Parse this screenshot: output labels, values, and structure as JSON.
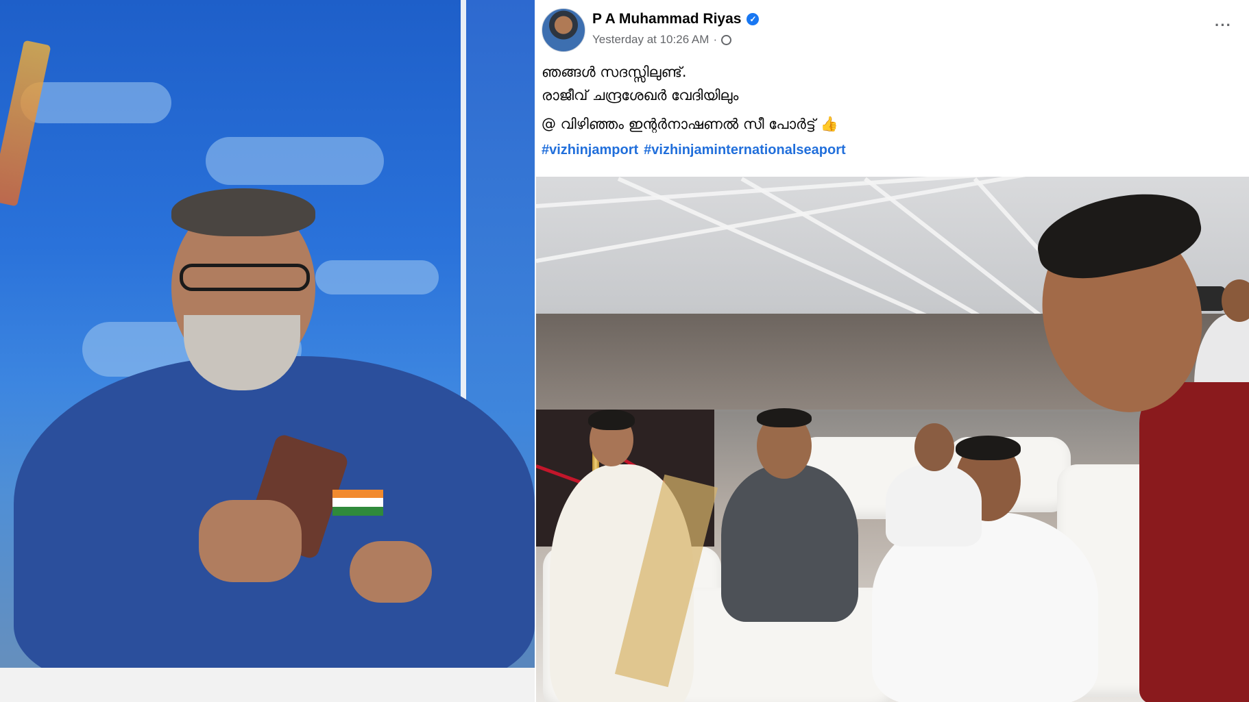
{
  "post": {
    "author": "P A Muhammad Riyas",
    "verified_mark": "✓",
    "timestamp": "Yesterday at 10:26 AM",
    "separator": "·",
    "more_menu": "···",
    "text_lines": [
      "ഞങ്ങൾ സദസ്സിലുണ്ട്.",
      "രാജീവ് ചന്ദ്രശേഖർ വേദിയിലും",
      "@ വിഴിഞ്ഞം ഇന്റർനാഷണൽ സീ പോർട്ട്"
    ],
    "thumb_emoji": "👍",
    "hashtags": [
      "#vizhinjamport",
      "#vizhinjaminternationalseaport"
    ]
  },
  "icons": {
    "verified": "verified-badge-icon",
    "audience": "globe-icon",
    "more": "more-options-icon",
    "thumb": "thumbs-up-icon"
  },
  "colors": {
    "link": "#216fdb",
    "verified": "#1877f2",
    "meta": "#65676b"
  }
}
